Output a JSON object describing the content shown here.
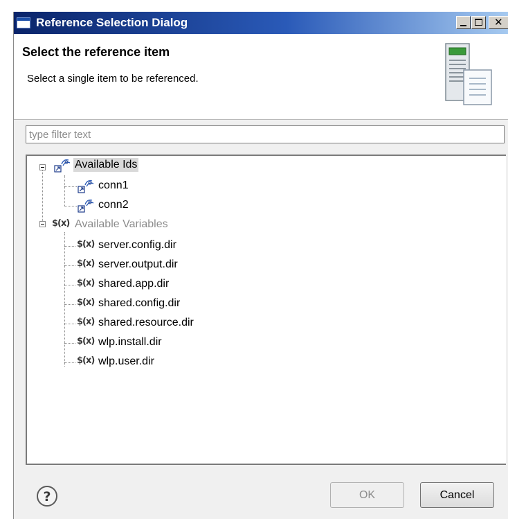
{
  "window": {
    "title": "Reference Selection Dialog",
    "controls": {
      "minimize": "minimize",
      "maximize": "maximize",
      "close": "✕"
    }
  },
  "header": {
    "title": "Select the reference item",
    "subtitle": "Select a single item to be referenced.",
    "icon": "server-document-icon"
  },
  "filter": {
    "placeholder": "type filter text",
    "value": ""
  },
  "tree": {
    "groups": [
      {
        "label": "Available Ids",
        "icon": "reference-id-icon",
        "expanded": true,
        "selected": true,
        "children": [
          "conn1",
          "conn2"
        ]
      },
      {
        "label": "Available Variables",
        "icon": "variable-icon",
        "expanded": true,
        "disabled": true,
        "children": [
          "server.config.dir",
          "server.output.dir",
          "shared.app.dir",
          "shared.config.dir",
          "shared.resource.dir",
          "wlp.install.dir",
          "wlp.user.dir"
        ]
      }
    ]
  },
  "footer": {
    "help_icon": "question-mark-help-icon",
    "ok_label": "OK",
    "cancel_label": "Cancel"
  },
  "colors": {
    "titlebar_start": "#0a246a",
    "titlebar_end": "#a6caf0",
    "selection": "#d9d9d9",
    "disabled_text": "#8c8c8c"
  }
}
